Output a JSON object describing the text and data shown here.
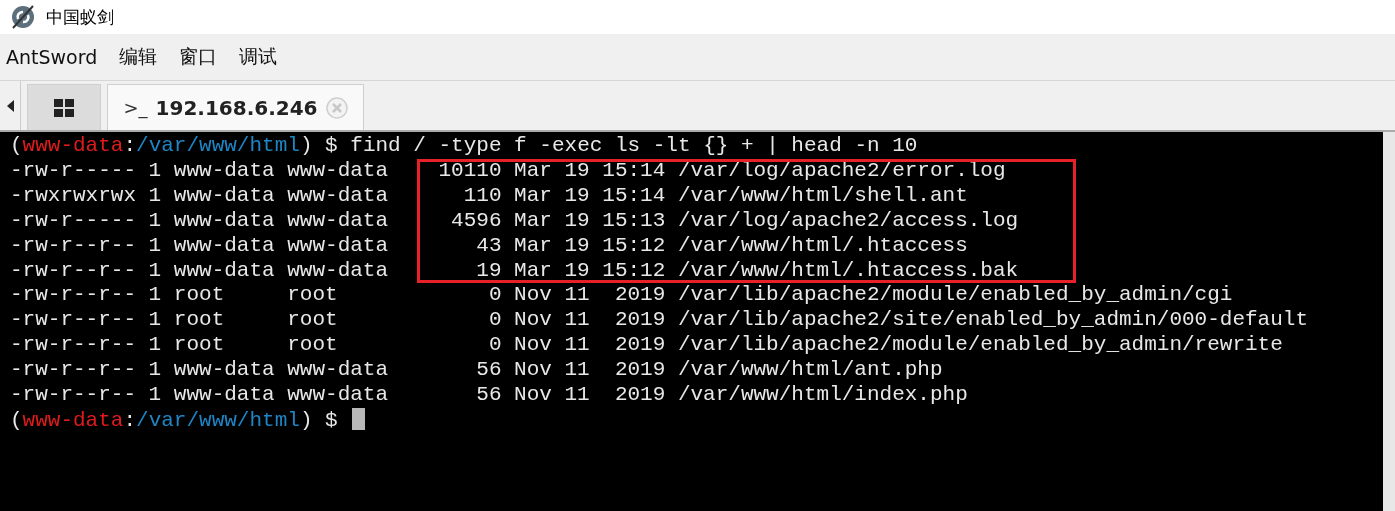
{
  "window": {
    "title": "中国蚁剑"
  },
  "menu": [
    "AntSword",
    "编辑",
    "窗口",
    "调试"
  ],
  "tabs": [
    {
      "kind": "home",
      "selected": false
    },
    {
      "kind": "terminal",
      "prefix": ">_",
      "label": "192.168.6.246",
      "selected": true
    }
  ],
  "terminal": {
    "prompt": {
      "open": "(",
      "user": "www-data",
      "sep": ":",
      "path": "/var/www/html",
      "tail": ") $"
    },
    "final_prompt": {
      "open": "(",
      "user": "www-data",
      "sep": ":",
      "path": "/var/www/html",
      "tail": ") $"
    },
    "command": "find / -type f -exec ls -lt {} + | head -n 10",
    "output": [
      {
        "text": "-rw-r----- 1 www-data www-data    10110 Mar 19 15:14 /var/log/apache2/error.log",
        "highlighted": true
      },
      {
        "text": "-rwxrwxrwx 1 www-data www-data      110 Mar 19 15:14 /var/www/html/shell.ant",
        "highlighted": true
      },
      {
        "text": "-rw-r----- 1 www-data www-data     4596 Mar 19 15:13 /var/log/apache2/access.log",
        "highlighted": true
      },
      {
        "text": "-rw-r--r-- 1 www-data www-data       43 Mar 19 15:12 /var/www/html/.htaccess",
        "highlighted": true
      },
      {
        "text": "-rw-r--r-- 1 www-data www-data       19 Mar 19 15:12 /var/www/html/.htaccess.bak",
        "highlighted": true
      },
      {
        "text": "-rw-r--r-- 1 root     root            0 Nov 11  2019 /var/lib/apache2/module/enabled_by_admin/cgi",
        "highlighted": false
      },
      {
        "text": "-rw-r--r-- 1 root     root            0 Nov 11  2019 /var/lib/apache2/site/enabled_by_admin/000-default",
        "highlighted": false
      },
      {
        "text": "-rw-r--r-- 1 root     root            0 Nov 11  2019 /var/lib/apache2/module/enabled_by_admin/rewrite",
        "highlighted": false
      },
      {
        "text": "-rw-r--r-- 1 www-data www-data       56 Nov 11  2019 /var/www/html/ant.php",
        "highlighted": false
      },
      {
        "text": "-rw-r--r-- 1 www-data www-data       56 Nov 11  2019 /var/www/html/index.php",
        "highlighted": false
      }
    ]
  }
}
